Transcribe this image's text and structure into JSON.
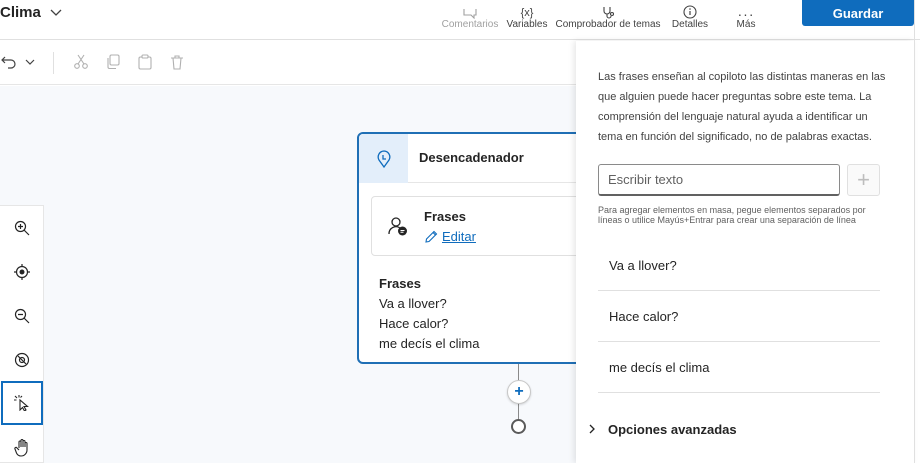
{
  "header": {
    "topic_title": "Clima",
    "toolbar": {
      "comments": "Comentarios",
      "variables": "Variables",
      "topic_checker": "Comprobador de temas",
      "details": "Detalles",
      "more": "Más"
    },
    "save_label": "Guardar"
  },
  "canvas": {
    "trigger_title": "Desencadenador",
    "phrases_card_label": "Frases",
    "edit_link": "Editar",
    "phrases_heading": "Frases",
    "phrases": [
      "Va a llover?",
      "Hace calor?",
      "me decís el clima"
    ]
  },
  "panel": {
    "description": "Las frases enseñan al copiloto las distintas maneras en las que alguien puede hacer preguntas sobre este tema. La comprensión del lenguaje natural ayuda a identificar un tema en función del significado, no de palabras exactas.",
    "input_placeholder": "Escribir texto",
    "bulk_hint": "Para agregar elementos en masa, pegue elementos separados por líneas o utilice Mayús+Entrar para crear una separación de línea",
    "phrases": [
      "Va a llover?",
      "Hace calor?",
      "me decís el clima"
    ],
    "advanced_label": "Opciones avanzadas"
  },
  "colors": {
    "accent": "#0f6cbd",
    "node_border": "#1f6fb5"
  }
}
